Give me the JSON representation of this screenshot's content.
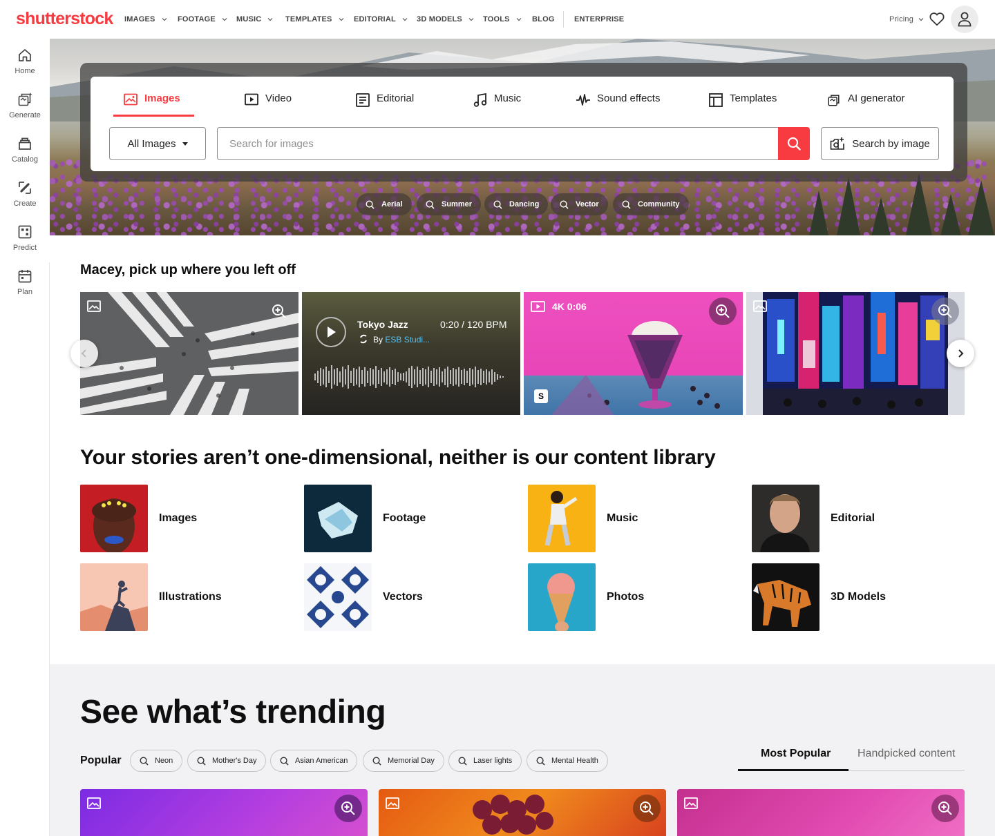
{
  "header": {
    "logo": "shutterstock",
    "nav": [
      {
        "label": "IMAGES",
        "chevron": true
      },
      {
        "label": "FOOTAGE",
        "chevron": true
      },
      {
        "label": "MUSIC",
        "chevron": true
      },
      {
        "label": "TEMPLATES",
        "chevron": true
      },
      {
        "label": "EDITORIAL",
        "chevron": true
      },
      {
        "label": "3D MODELS",
        "chevron": true
      },
      {
        "label": "TOOLS",
        "chevron": true
      },
      {
        "label": "BLOG",
        "chevron": false
      },
      {
        "label": "ENTERPRISE",
        "chevron": false
      }
    ],
    "pricing_label": "Pricing"
  },
  "sidebar": {
    "items": [
      {
        "label": "Home",
        "icon": "home-icon"
      },
      {
        "label": "Generate",
        "icon": "generate-icon"
      },
      {
        "label": "Catalog",
        "icon": "catalog-icon"
      },
      {
        "label": "Create",
        "icon": "create-icon"
      },
      {
        "label": "Predict",
        "icon": "predict-icon"
      },
      {
        "label": "Plan",
        "icon": "plan-icon"
      }
    ]
  },
  "search": {
    "tabs": [
      {
        "label": "Images",
        "icon": "image-icon",
        "active": true
      },
      {
        "label": "Video",
        "icon": "video-icon",
        "active": false
      },
      {
        "label": "Editorial",
        "icon": "editorial-icon",
        "active": false
      },
      {
        "label": "Music",
        "icon": "music-icon",
        "active": false
      },
      {
        "label": "Sound effects",
        "icon": "waveform-icon",
        "active": false
      },
      {
        "label": "Templates",
        "icon": "templates-icon",
        "active": false
      },
      {
        "label": "AI generator",
        "icon": "ai-generator-icon",
        "active": false
      }
    ],
    "filter_label": "All Images",
    "placeholder": "Search for images",
    "value": "",
    "search_by_image_label": "Search by image",
    "suggestions": [
      "Aerial",
      "Summer",
      "Dancing",
      "Vector",
      "Community"
    ]
  },
  "recent": {
    "title": "Macey, pick up where you left off",
    "music": {
      "title": "Tokyo Jazz",
      "meta": "0:20 / 120 BPM",
      "by": "By",
      "artist": "ESB Studi..."
    },
    "video": {
      "badge": "4K 0:06",
      "s_badge": "S"
    }
  },
  "library": {
    "title": "Your stories aren’t one-dimensional, neither is our content library",
    "items": [
      "Images",
      "Footage",
      "Music",
      "Editorial",
      "Illustrations",
      "Vectors",
      "Photos",
      "3D Models"
    ]
  },
  "trending": {
    "title": "See what’s trending",
    "popular_label": "Popular",
    "chips": [
      "Neon",
      "Mother's Day",
      "Asian American",
      "Memorial Day",
      "Laser lights",
      "Mental Health"
    ],
    "tabs": [
      {
        "label": "Most Popular",
        "active": true
      },
      {
        "label": "Handpicked content",
        "active": false
      }
    ]
  },
  "colors": {
    "brand": "#f73b40",
    "text": "#0f0f0f",
    "trend_bg": "#f2f2f4"
  }
}
